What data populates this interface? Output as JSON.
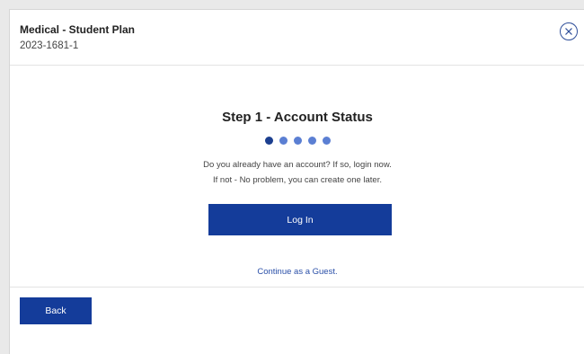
{
  "header": {
    "plan_title": "Medical - Student Plan",
    "plan_id": "2023-1681-1",
    "close_icon": "close-circle-icon"
  },
  "step": {
    "title": "Step 1 - Account Status",
    "progress": {
      "current": 1,
      "total": 5
    }
  },
  "message": {
    "line1": "Do you already have an account? If so, login now.",
    "line2": "If not - No problem, you can create one later."
  },
  "actions": {
    "login_label": "Log In",
    "guest_label": "Continue as a Guest.",
    "back_label": "Back"
  },
  "colors": {
    "primary": "#143c9a",
    "dot_active": "#1c3f8f",
    "dot_inactive": "#5b7fd3",
    "link": "#2a4fa8"
  }
}
